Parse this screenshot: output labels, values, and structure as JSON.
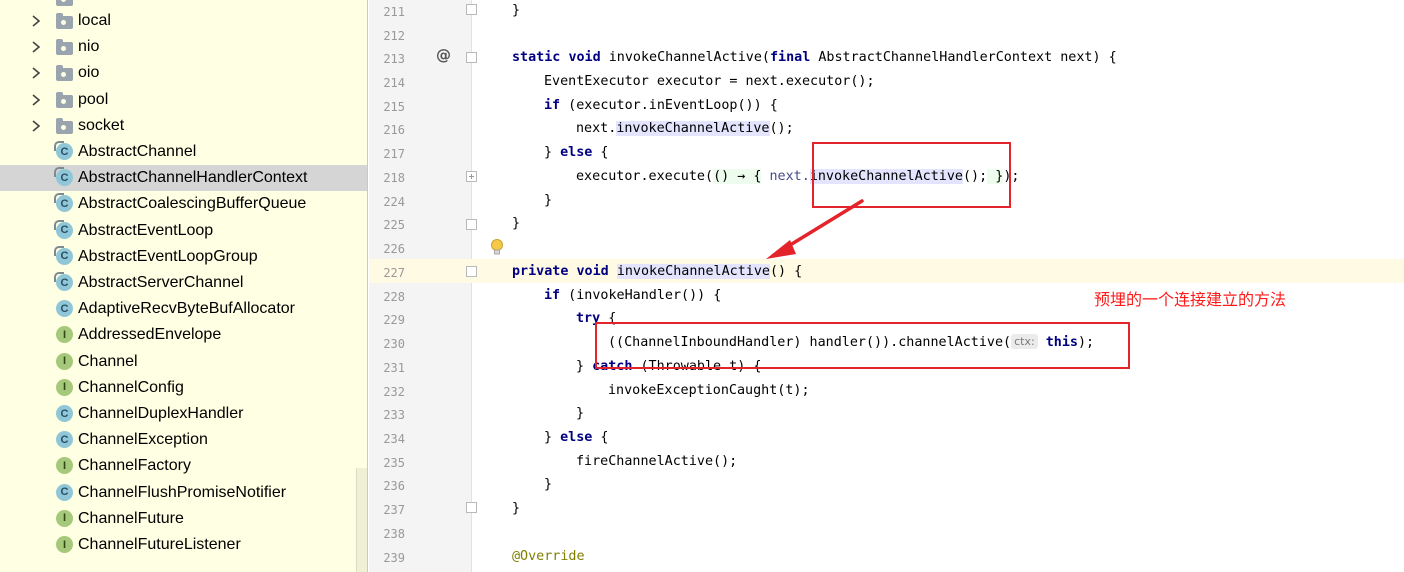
{
  "tree": {
    "items": [
      {
        "label": "local",
        "type": "package",
        "collapsed": true
      },
      {
        "label": "nio",
        "type": "package",
        "collapsed": true
      },
      {
        "label": "oio",
        "type": "package",
        "collapsed": true
      },
      {
        "label": "pool",
        "type": "package",
        "collapsed": true
      },
      {
        "label": "socket",
        "type": "package",
        "collapsed": true
      },
      {
        "label": "AbstractChannel",
        "type": "abstract-class"
      },
      {
        "label": "AbstractChannelHandlerContext",
        "type": "abstract-class",
        "selected": true
      },
      {
        "label": "AbstractCoalescingBufferQueue",
        "type": "abstract-class"
      },
      {
        "label": "AbstractEventLoop",
        "type": "abstract-class"
      },
      {
        "label": "AbstractEventLoopGroup",
        "type": "abstract-class"
      },
      {
        "label": "AbstractServerChannel",
        "type": "abstract-class"
      },
      {
        "label": "AdaptiveRecvByteBufAllocator",
        "type": "class"
      },
      {
        "label": "AddressedEnvelope",
        "type": "interface"
      },
      {
        "label": "Channel",
        "type": "interface"
      },
      {
        "label": "ChannelConfig",
        "type": "interface"
      },
      {
        "label": "ChannelDuplexHandler",
        "type": "class"
      },
      {
        "label": "ChannelException",
        "type": "class"
      },
      {
        "label": "ChannelFactory",
        "type": "interface"
      },
      {
        "label": "ChannelFlushPromiseNotifier",
        "type": "class"
      },
      {
        "label": "ChannelFuture",
        "type": "interface"
      },
      {
        "label": "ChannelFutureListener",
        "type": "interface"
      }
    ]
  },
  "editor": {
    "line_numbers": [
      "211",
      "212",
      "213",
      "214",
      "215",
      "216",
      "217",
      "218",
      "224",
      "225",
      "226",
      "227",
      "228",
      "229",
      "230",
      "231",
      "232",
      "233",
      "234",
      "235",
      "236",
      "237",
      "238",
      "239"
    ],
    "lines": {
      "l211": "}",
      "l213_kw1": "static",
      "l213_kw2": "void",
      "l213_name": " invokeChannelActive(",
      "l213_kw3": "final",
      "l213_rest": " AbstractChannelHandlerContext next) {",
      "l214": "EventExecutor executor = next.executor();",
      "l215_kw": "if",
      "l215_rest": " (executor.inEventLoop()) {",
      "l216_pre": "next.",
      "l216_method": "invokeChannelActive",
      "l216_post": "();",
      "l217_pre": "} ",
      "l217_kw": "else",
      "l217_post": " {",
      "l218_pre": "executor.execute(",
      "l218_lambda": "() → {",
      "l218_next": " next.",
      "l218_method": "invokeChannelActive",
      "l218_call": "();",
      "l218_close": " }",
      "l218_end": ");",
      "l224": "}",
      "l225": "}",
      "l227_kw1": "private",
      "l227_kw2": "void",
      "l227_method": "invokeChannelActive",
      "l227_post": "() {",
      "l228_kw": "if",
      "l228_rest": " (invokeHandler()) {",
      "l229_kw": "try",
      "l229_rest": " {",
      "l230_pre": "((ChannelInboundHandler) handler()).channelActive(",
      "l230_hint": "ctx:",
      "l230_kw": "this",
      "l230_post": ");",
      "l231_pre": "} ",
      "l231_kw": "catch",
      "l231_rest": " (Throwable t) {",
      "l232": "invokeExceptionCaught(t);",
      "l233": "}",
      "l234_pre": "} ",
      "l234_kw": "else",
      "l234_post": " {",
      "l235": "fireChannelActive();",
      "l236": "}",
      "l237": "}",
      "l239": "@Override"
    }
  },
  "annotation": {
    "text": "预埋的一个连接建立的方法",
    "color": "#ff1a1a"
  },
  "colors": {
    "keyword": "#000080",
    "tree_bg": "#ffffe4",
    "selection": "#d5d5d5",
    "current_line": "#fffae3",
    "annotation_red": "#e3242b"
  }
}
